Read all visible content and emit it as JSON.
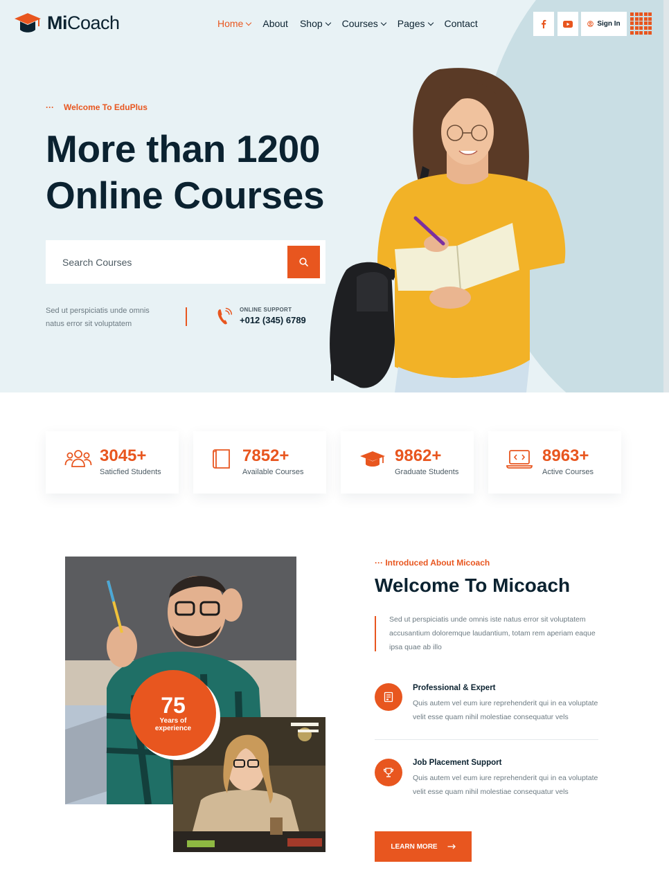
{
  "brand": {
    "name_bold": "Mi",
    "name_rest": "Coach",
    "accent": "#e8561f",
    "dark": "#0b2230",
    "hero_bg": "#e8f2f5"
  },
  "nav": {
    "items": [
      {
        "label": "Home",
        "dropdown": true,
        "active": true
      },
      {
        "label": "About",
        "dropdown": false,
        "active": false
      },
      {
        "label": "Shop",
        "dropdown": true,
        "active": false
      },
      {
        "label": "Courses",
        "dropdown": true,
        "active": false
      },
      {
        "label": "Pages",
        "dropdown": true,
        "active": false
      },
      {
        "label": "Contact",
        "dropdown": false,
        "active": false
      }
    ],
    "signin": "Sign In"
  },
  "hero": {
    "eyebrow": "Welcome To EduPlus",
    "headline_line1": "More than 1200",
    "headline_line2": "Online Courses",
    "search_placeholder": "Search Courses",
    "desc": "Sed ut perspiciatis unde omnis natus error sit voluptatem",
    "support_label": "ONLINE SUPPORT",
    "support_phone": "+012 (345) 6789"
  },
  "stats": [
    {
      "value": "3045+",
      "label": "Saticfied Students",
      "icon": "students-icon"
    },
    {
      "value": "7852+",
      "label": "Available Courses",
      "icon": "book-icon"
    },
    {
      "value": "9862+",
      "label": "Graduate Students",
      "icon": "graduation-cap-icon"
    },
    {
      "value": "8963+",
      "label": "Active Courses",
      "icon": "laptop-code-icon"
    }
  ],
  "about": {
    "experience_number": "75",
    "experience_text1": "Years of",
    "experience_text2": "experience",
    "eyebrow": "Introduced About Micoach",
    "title": "Welcome To Micoach",
    "desc": "Sed ut perspiciatis unde omnis iste natus error sit voluptatem accusantium doloremque laudantium, totam rem aperiam eaque ipsa quae ab illo",
    "features": [
      {
        "title": "Professional & Expert",
        "desc": "Quis autem vel eum iure reprehenderit qui in ea voluptate velit esse quam nihil molestiae consequatur vels"
      },
      {
        "title": "Job Placement Support",
        "desc": "Quis autem vel eum iure reprehenderit qui in ea voluptate velit esse quam nihil molestiae consequatur vels"
      }
    ],
    "button": "LEARN MORE"
  }
}
